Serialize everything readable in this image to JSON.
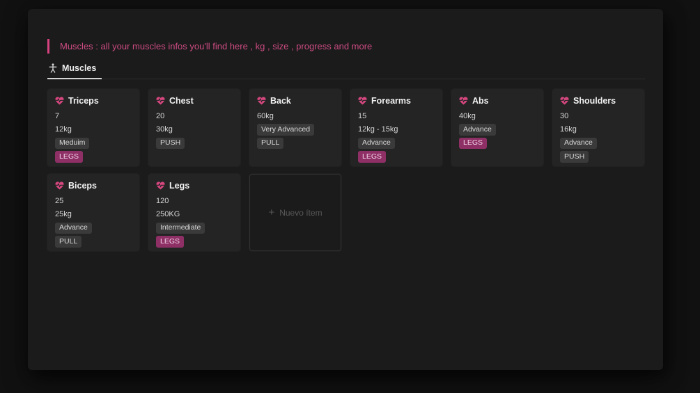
{
  "header": {
    "quote": "Muscles : all your muscles infos you'll find here , kg , size , progress and more"
  },
  "tabs": [
    {
      "label": "Muscles",
      "icon": "person-icon",
      "active": true
    }
  ],
  "colors": {
    "accent_pink": "#d6427f",
    "quote_text": "#cc4b82",
    "tag_pink_bg": "#8e2f66",
    "badge_gray_bg": "#3a3a3a",
    "panel_bg": "#1b1b1b",
    "card_bg": "#242424",
    "page_bg": "#111111"
  },
  "gallery": {
    "cards": [
      {
        "title": "Triceps",
        "icon": "heart-pulse-icon",
        "fields": [
          {
            "type": "text",
            "value": "7"
          },
          {
            "type": "text",
            "value": "12kg"
          },
          {
            "type": "badge",
            "color": "gray",
            "value": "Meduim"
          },
          {
            "type": "badge",
            "color": "pink",
            "value": "LEGS"
          }
        ]
      },
      {
        "title": "Chest",
        "icon": "heart-pulse-icon",
        "fields": [
          {
            "type": "text",
            "value": "20"
          },
          {
            "type": "text",
            "value": "30kg"
          },
          {
            "type": "badge",
            "color": "gray",
            "value": "PUSH"
          }
        ]
      },
      {
        "title": "Back",
        "icon": "heart-pulse-icon",
        "fields": [
          {
            "type": "text",
            "value": "60kg"
          },
          {
            "type": "badge",
            "color": "gray",
            "value": "Very Advanced"
          },
          {
            "type": "badge",
            "color": "gray",
            "value": "PULL"
          }
        ]
      },
      {
        "title": "Forearms",
        "icon": "heart-pulse-icon",
        "fields": [
          {
            "type": "text",
            "value": "15"
          },
          {
            "type": "text",
            "value": "12kg - 15kg"
          },
          {
            "type": "badge",
            "color": "gray",
            "value": "Advance"
          },
          {
            "type": "badge",
            "color": "pink",
            "value": "LEGS"
          }
        ]
      },
      {
        "title": "Abs",
        "icon": "heart-pulse-icon",
        "fields": [
          {
            "type": "text",
            "value": "40kg"
          },
          {
            "type": "badge",
            "color": "gray",
            "value": "Advance"
          },
          {
            "type": "badge",
            "color": "pink",
            "value": "LEGS"
          }
        ]
      },
      {
        "title": "Shoulders",
        "icon": "heart-pulse-icon",
        "fields": [
          {
            "type": "text",
            "value": "30"
          },
          {
            "type": "text",
            "value": "16kg"
          },
          {
            "type": "badge",
            "color": "gray",
            "value": "Advance"
          },
          {
            "type": "badge",
            "color": "gray",
            "value": "PUSH"
          }
        ]
      },
      {
        "title": "Biceps",
        "icon": "heart-pulse-icon",
        "fields": [
          {
            "type": "text",
            "value": "25"
          },
          {
            "type": "text",
            "value": "25kg"
          },
          {
            "type": "badge",
            "color": "gray",
            "value": "Advance"
          },
          {
            "type": "badge",
            "color": "gray",
            "value": "PULL"
          }
        ]
      },
      {
        "title": "Legs",
        "icon": "heart-pulse-icon",
        "fields": [
          {
            "type": "text",
            "value": "120"
          },
          {
            "type": "text",
            "value": "250KG"
          },
          {
            "type": "badge",
            "color": "gray",
            "value": "Intermediate"
          },
          {
            "type": "badge",
            "color": "pink",
            "value": "LEGS"
          }
        ]
      }
    ],
    "new_item": {
      "plus": "+",
      "label": "Nuevo ítem"
    }
  }
}
